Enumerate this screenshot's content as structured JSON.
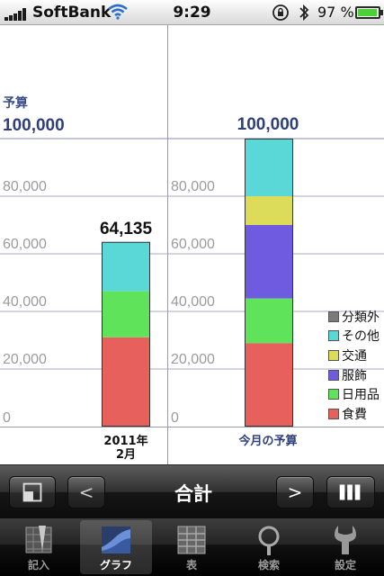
{
  "status_bar": {
    "carrier": "SoftBank",
    "time": "9:29",
    "battery_percent": "97 %",
    "battery_level": 0.97,
    "signal_bars": 5
  },
  "chart_data": {
    "type": "bar",
    "stacked": true,
    "title": "",
    "budget_label": "予算",
    "budget_value_text": "100,000",
    "budget_value": 100000,
    "ylim": [
      0,
      100000
    ],
    "yticks": [
      0,
      20000,
      40000,
      60000,
      80000,
      100000
    ],
    "ytick_labels": [
      "0",
      "20,000",
      "40,000",
      "60,000",
      "80,000"
    ],
    "categories": [
      {
        "label_line1": "2011年",
        "label_line2": "2月",
        "total_label": "64,135",
        "color": "#111111"
      },
      {
        "label_line1": "今月の予算",
        "label_line2": "",
        "total_label": "100,000",
        "color": "#2f3f7a"
      }
    ],
    "series": [
      {
        "name": "食費",
        "color": "#e8605c",
        "values": [
          31000,
          29000
        ]
      },
      {
        "name": "日用品",
        "color": "#5ee35a",
        "values": [
          16000,
          15500
        ]
      },
      {
        "name": "服飾",
        "color": "#0000ff",
        "values": [
          0,
          25500
        ]
      },
      {
        "name": "交通",
        "color": "#dcdc5a",
        "values": [
          0,
          10000
        ]
      },
      {
        "name": "その他",
        "color": "#5ad7d7",
        "values": [
          17135,
          20000
        ]
      },
      {
        "name": "分類外",
        "color": "#7b7b7b",
        "values": [
          0,
          0
        ]
      }
    ],
    "legend_position": "right",
    "grid": true
  },
  "chart_colors": {
    "serviceColor": "#6f5be0"
  },
  "toolbar": {
    "title": "合計",
    "prev_label": "<",
    "next_label": ">"
  },
  "tabs": [
    {
      "label": "記入",
      "icon": "pencil-ledger-icon"
    },
    {
      "label": "グラフ",
      "icon": "graph-icon",
      "active": true
    },
    {
      "label": "表",
      "icon": "table-icon"
    },
    {
      "label": "検索",
      "icon": "search-icon"
    },
    {
      "label": "設定",
      "icon": "wrench-icon"
    }
  ]
}
